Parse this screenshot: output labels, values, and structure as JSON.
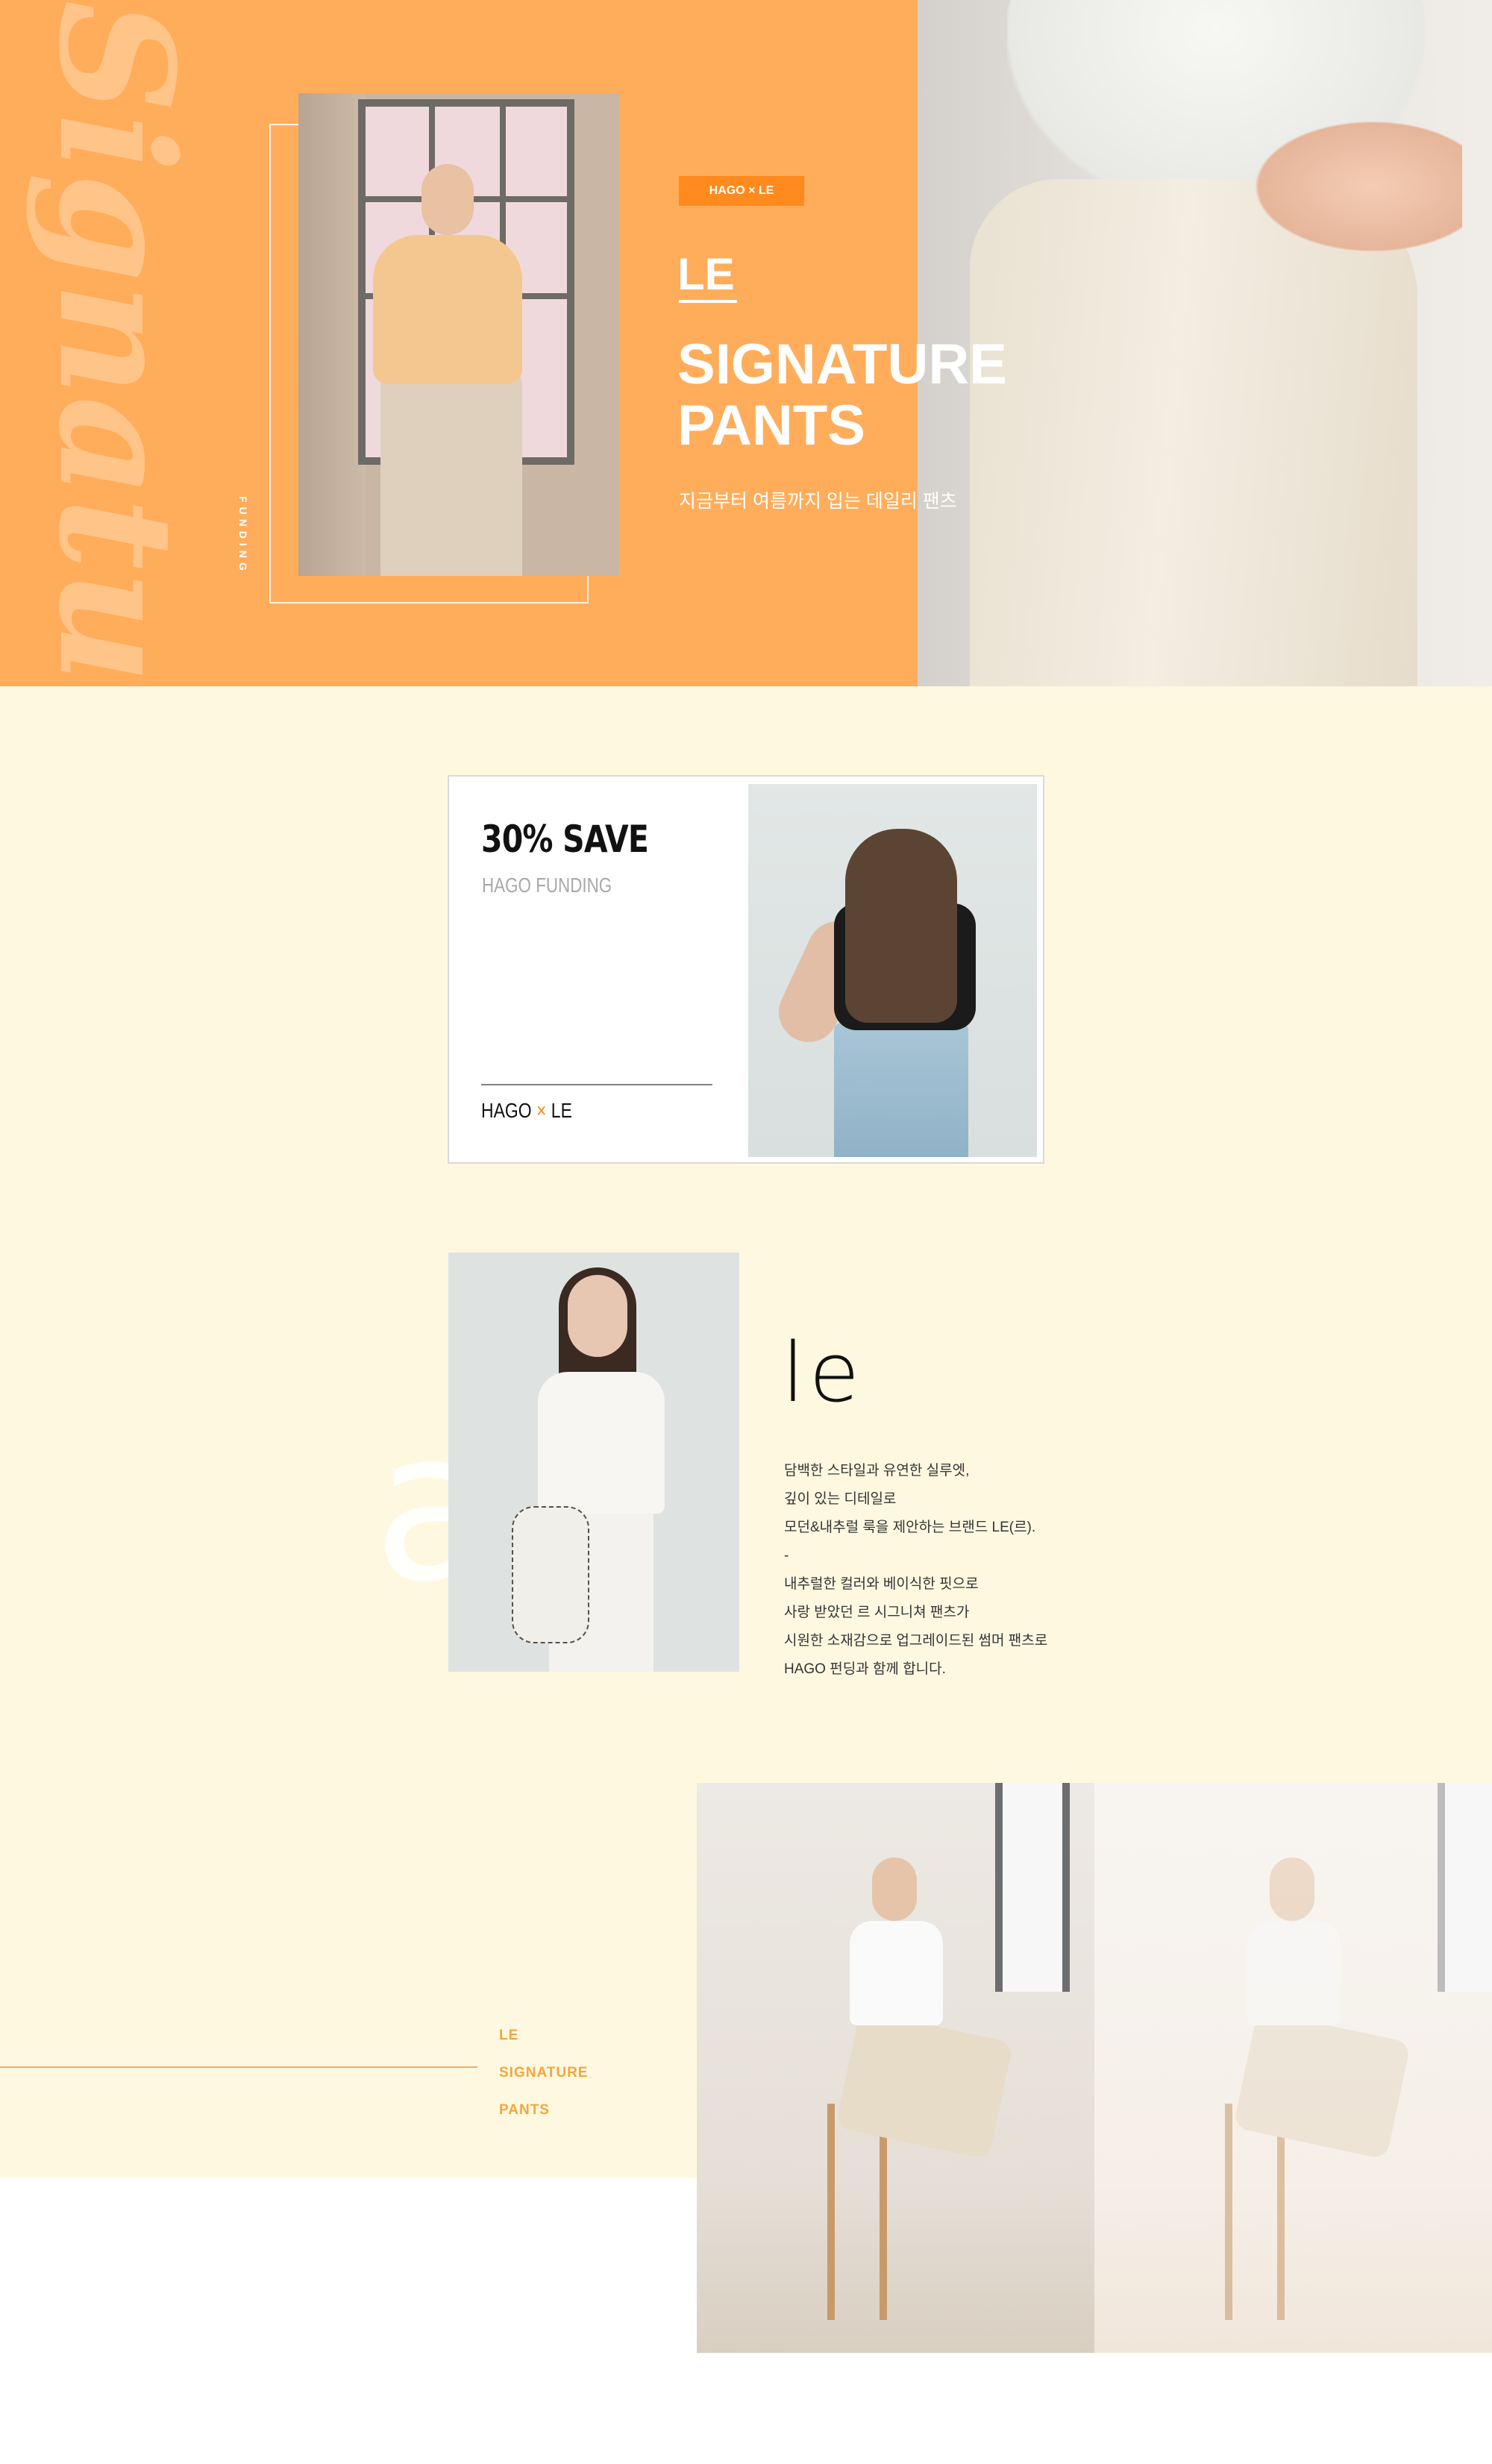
{
  "hero": {
    "bg_script": "Signature",
    "side_label": "FUNDING",
    "badge": "HAGO × LE",
    "le": "LE",
    "title_line1": "SIGNATURE",
    "title_line2": "PANTS",
    "subtitle": "지금부터 여름까지 입는 데일리 팬츠"
  },
  "save_card": {
    "title": "30% SAVE",
    "subtitle": "HAGO FUNDING",
    "brand_left": "HAGO",
    "brand_x": "×",
    "brand_right": "LE"
  },
  "brand": {
    "logo": "le",
    "bg_letter": "a",
    "description": [
      "담백한 스타일과 유연한 실루엣,",
      "깊이 있는 디테일로",
      "모던&내추럴 룩을 제안하는 브랜드 LE(르).",
      "-",
      "내추럴한 컬러와 베이식한 핏으로",
      "사랑 받았던 르 시그니쳐 팬츠가",
      "시원한 소재감으로 업그레이드된 썸머 팬츠로",
      "HAGO 펀딩과 함께 합니다."
    ]
  },
  "lookbook": {
    "labels": [
      "LE",
      "SIGNATURE",
      "PANTS"
    ]
  },
  "colors": {
    "hero_orange": "#ffad5b",
    "badge_orange": "#ff8a1d",
    "cream_bg": "#fff8e1",
    "accent_text": "#f4a63c"
  }
}
